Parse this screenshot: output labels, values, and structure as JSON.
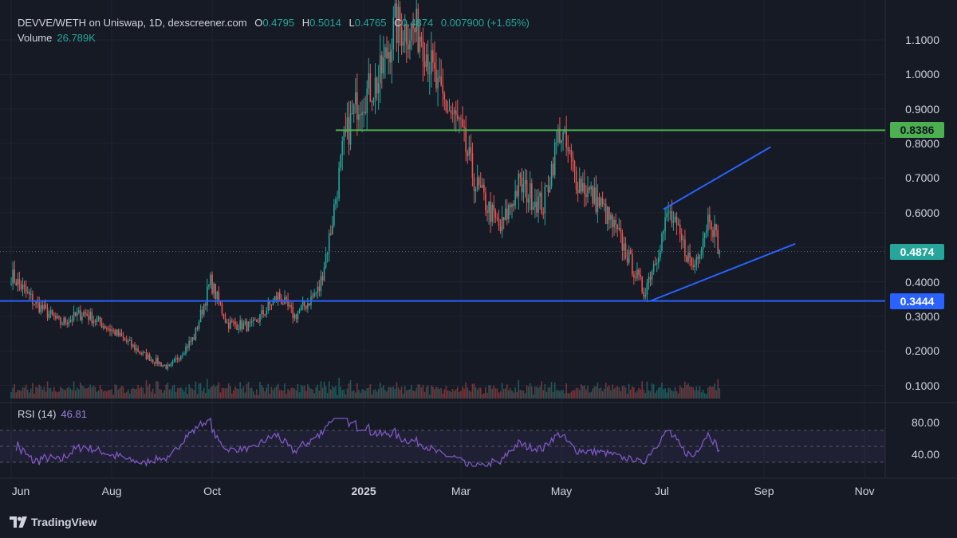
{
  "header": {
    "symbol": "DEVVE/WETH on Uniswap, 1D, dexscreener.com",
    "o_label": "O",
    "o_value": "0.4795",
    "h_label": "H",
    "h_value": "0.5014",
    "l_label": "L",
    "l_value": "0.4765",
    "c_label": "C",
    "c_value": "0.4874",
    "change": "0.007900 (+1.65%)",
    "volume_label": "Volume",
    "volume_value": "26.789K"
  },
  "rsi": {
    "label": "RSI (14)",
    "value": "46.81",
    "ticks": [
      "80.00",
      "40.00"
    ]
  },
  "brand": "TradingView",
  "colors": {
    "up": "#26a69a",
    "down": "#ef5350",
    "support": "#2962ff",
    "resistance": "#4caf50",
    "rsi": "#7e57c2",
    "background": "#161a25"
  },
  "chart_data": {
    "type": "candlestick",
    "y_ticks": [
      "1.1000",
      "1.0000",
      "0.9000",
      "0.8000",
      "0.7000",
      "0.6000",
      "0.4000",
      "0.3000",
      "0.2000",
      "0.1000"
    ],
    "ylim": [
      0.05,
      1.15
    ],
    "x_ticks": [
      "Jun",
      "Aug",
      "Oct",
      "2025",
      "Mar",
      "May",
      "Jul",
      "Sep",
      "Nov"
    ],
    "price_levels": [
      {
        "value": 0.8386,
        "label": "0.8386",
        "color": "#4caf50"
      },
      {
        "value": 0.4874,
        "label": "0.4874",
        "color": "#26a69a",
        "dotted": true
      },
      {
        "value": 0.3444,
        "label": "0.3444",
        "color": "#2962ff"
      }
    ],
    "close_path": [
      [
        "2024-06-01",
        0.42
      ],
      [
        "2024-06-15",
        0.34
      ],
      [
        "2024-07-01",
        0.28
      ],
      [
        "2024-07-15",
        0.31
      ],
      [
        "2024-08-01",
        0.26
      ],
      [
        "2024-08-20",
        0.19
      ],
      [
        "2024-09-05",
        0.15
      ],
      [
        "2024-09-20",
        0.24
      ],
      [
        "2024-09-30",
        0.4
      ],
      [
        "2024-10-10",
        0.28
      ],
      [
        "2024-10-25",
        0.27
      ],
      [
        "2024-11-10",
        0.36
      ],
      [
        "2024-11-20",
        0.3
      ],
      [
        "2024-11-28",
        0.34
      ],
      [
        "2024-12-05",
        0.38
      ],
      [
        "2024-12-12",
        0.55
      ],
      [
        "2024-12-20",
        0.8
      ],
      [
        "2024-12-28",
        0.92
      ],
      [
        "2025-01-10",
        0.98
      ],
      [
        "2025-01-20",
        1.14
      ],
      [
        "2025-02-05",
        1.12
      ],
      [
        "2025-02-15",
        0.95
      ],
      [
        "2025-02-28",
        0.85
      ],
      [
        "2025-03-10",
        0.68
      ],
      [
        "2025-03-25",
        0.55
      ],
      [
        "2025-04-05",
        0.68
      ],
      [
        "2025-04-20",
        0.62
      ],
      [
        "2025-04-30",
        0.84
      ],
      [
        "2025-05-10",
        0.7
      ],
      [
        "2025-05-25",
        0.62
      ],
      [
        "2025-06-05",
        0.53
      ],
      [
        "2025-06-20",
        0.37
      ],
      [
        "2025-06-28",
        0.48
      ],
      [
        "2025-07-05",
        0.6
      ],
      [
        "2025-07-20",
        0.44
      ],
      [
        "2025-07-30",
        0.6
      ],
      [
        "2025-08-05",
        0.49
      ]
    ],
    "trendlines": [
      {
        "color": "#2962ff",
        "points": [
          [
            "2025-07-02",
            0.61
          ],
          [
            "2025-09-05",
            0.79
          ]
        ]
      },
      {
        "color": "#2962ff",
        "points": [
          [
            "2025-06-24",
            0.3444
          ],
          [
            "2025-09-20",
            0.51
          ]
        ]
      },
      {
        "color": "#4caf50",
        "points": [
          [
            "2024-12-15",
            0.8386
          ],
          [
            "2025-11-30",
            0.8386
          ]
        ]
      },
      {
        "color": "#2962ff",
        "points": [
          [
            "2024-05-01",
            0.3444
          ],
          [
            "2025-11-30",
            0.3444
          ]
        ]
      }
    ],
    "rsi_range": [
      20,
      90
    ],
    "rsi_bands": [
      70,
      50,
      30
    ]
  }
}
